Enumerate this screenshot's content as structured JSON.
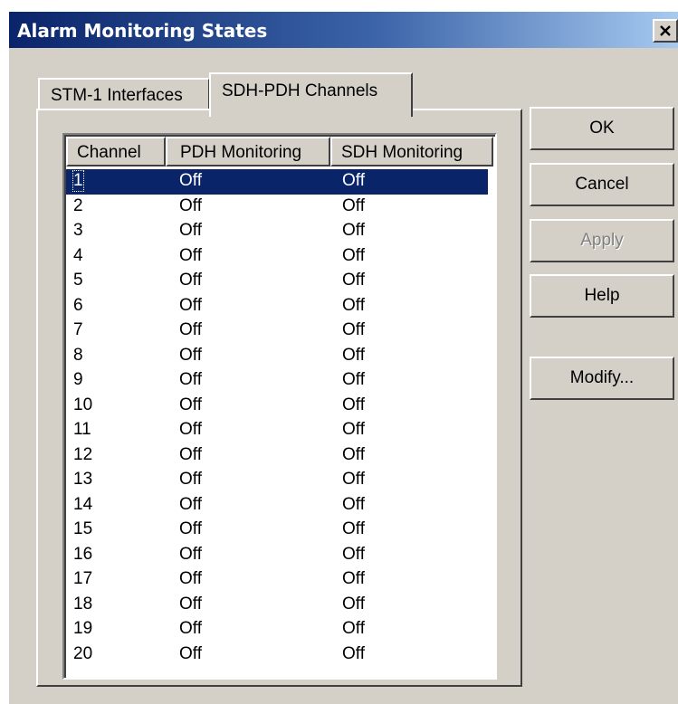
{
  "window": {
    "title": "Alarm Monitoring States",
    "close_label": "×"
  },
  "tabs": [
    {
      "label": "STM-1 Interfaces",
      "active": false
    },
    {
      "label": "SDH-PDH Channels",
      "active": true
    }
  ],
  "table": {
    "columns": [
      "Channel",
      "PDH Monitoring",
      "SDH Monitoring"
    ],
    "selected_index": 0,
    "rows": [
      {
        "channel": "1",
        "pdh": "Off",
        "sdh": "Off"
      },
      {
        "channel": "2",
        "pdh": "Off",
        "sdh": "Off"
      },
      {
        "channel": "3",
        "pdh": "Off",
        "sdh": "Off"
      },
      {
        "channel": "4",
        "pdh": "Off",
        "sdh": "Off"
      },
      {
        "channel": "5",
        "pdh": "Off",
        "sdh": "Off"
      },
      {
        "channel": "6",
        "pdh": "Off",
        "sdh": "Off"
      },
      {
        "channel": "7",
        "pdh": "Off",
        "sdh": "Off"
      },
      {
        "channel": "8",
        "pdh": "Off",
        "sdh": "Off"
      },
      {
        "channel": "9",
        "pdh": "Off",
        "sdh": "Off"
      },
      {
        "channel": "10",
        "pdh": "Off",
        "sdh": "Off"
      },
      {
        "channel": "11",
        "pdh": "Off",
        "sdh": "Off"
      },
      {
        "channel": "12",
        "pdh": "Off",
        "sdh": "Off"
      },
      {
        "channel": "13",
        "pdh": "Off",
        "sdh": "Off"
      },
      {
        "channel": "14",
        "pdh": "Off",
        "sdh": "Off"
      },
      {
        "channel": "15",
        "pdh": "Off",
        "sdh": "Off"
      },
      {
        "channel": "16",
        "pdh": "Off",
        "sdh": "Off"
      },
      {
        "channel": "17",
        "pdh": "Off",
        "sdh": "Off"
      },
      {
        "channel": "18",
        "pdh": "Off",
        "sdh": "Off"
      },
      {
        "channel": "19",
        "pdh": "Off",
        "sdh": "Off"
      },
      {
        "channel": "20",
        "pdh": "Off",
        "sdh": "Off"
      }
    ]
  },
  "buttons": {
    "ok": "OK",
    "cancel": "Cancel",
    "apply": "Apply",
    "help": "Help",
    "modify": "Modify..."
  },
  "colors": {
    "selection": "#0a246a",
    "dialog_face": "#d4d0c8",
    "title_gradient_start": "#0a246a",
    "title_gradient_end": "#a6caf0"
  }
}
